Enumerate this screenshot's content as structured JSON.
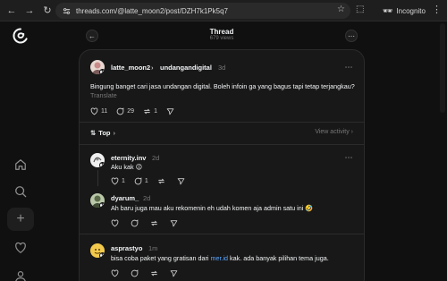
{
  "browser": {
    "url": "threads.com/@latte_moon2/post/DZH7k1Pk5q7",
    "incognito_label": "Incognito"
  },
  "header": {
    "title": "Thread",
    "views": "679 views"
  },
  "main_post": {
    "username": "latte_moon2",
    "separator": "›",
    "replied_user": "undangandigital",
    "time": "3d",
    "text": "Bingung banget cari jasa undangan digital. Boleh infoin ga yang bagus tapi tetap terjangkau?",
    "translate": "Translate",
    "likes": "11",
    "comments": "29",
    "reposts": "1"
  },
  "sort": {
    "label": "Top",
    "view_activity": "View activity"
  },
  "replies": [
    {
      "username": "eternity.inv",
      "time": "2d",
      "text": "Aku kak 😉",
      "likes": "1",
      "comments": "1"
    },
    {
      "username": "dyarum_",
      "time": "2d",
      "text": "Ah baru juga mau aku rekomenin eh udah komen aja admin satu ini 🤣"
    },
    {
      "username": "asprastyo",
      "time": "1m",
      "text_before": "bisa coba paket yang gratisan dari ",
      "link": "mer.id",
      "text_after": " kak. ada banyak pilihan tema juga."
    }
  ]
}
